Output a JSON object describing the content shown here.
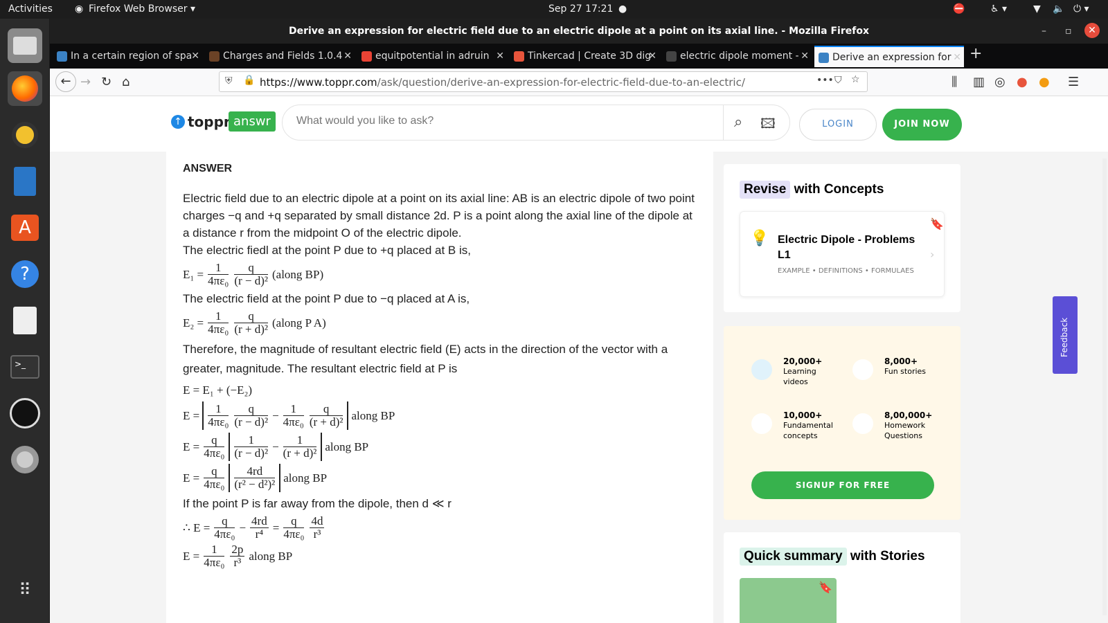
{
  "system": {
    "activities": "Activities",
    "app_menu": "Firefox Web Browser ▾",
    "clock": "Sep 27  17:21"
  },
  "window": {
    "title": "Derive an expression for electric field due to an electric dipole at a point on its axial line. - Mozilla Firefox"
  },
  "tabs": [
    {
      "label": "In a certain region of spa",
      "color": "#3b82c4"
    },
    {
      "label": "Charges and Fields 1.0.4",
      "color": "#6b4226"
    },
    {
      "label": "equitpotential in adruin",
      "color": "#ea4335"
    },
    {
      "label": "Tinkercad | Create 3D dig",
      "color": "#e8553c"
    },
    {
      "label": "electric dipole moment -",
      "color": "#444444"
    },
    {
      "label": "Derive an expression for",
      "color": "#3b82c4"
    }
  ],
  "url": {
    "host": "https://www.toppr.com",
    "path": "/ask/question/derive-an-expression-for-electric-field-due-to-an-electric/"
  },
  "header": {
    "logo": "toppr",
    "answr": "answr",
    "search_placeholder": "What would you like to ask?",
    "login": "LOGIN",
    "join": "JOIN NOW"
  },
  "answer": {
    "heading": "ANSWER",
    "p1": "Electric field due to an electric dipole at a point on its axial line: AB is an electric dipole of two point charges −q and +q separated by small distance 2d. P  is a point along the axial line of the dipole at a distance r from the midpoint O of the electric dipole.",
    "p2": "The electric fiedl at the point P  due to +q placed at B is,",
    "e1_label": "E₁ =",
    "e1_suffix": "(along BP)",
    "p3": "The electric field at the point P  due to −q placed at A is,",
    "e2_label": "E₂ =",
    "e2_suffix": "(along P A)",
    "p4": "Therefore, the magnitude of resultant electric field (E) acts in the direction of the vector with a greater, magnitude. The resultant electric field at P  is",
    "e3": "E = E₁ + (−E₂)",
    "along": "along BP",
    "p5": "If the point P  is far away from the dipole, then d ≪ r",
    "therefore": "∴ E ="
  },
  "sidebar": {
    "revise_pill": "Revise",
    "revise_rest": "with Concepts",
    "card_title": "Electric Dipole - Problems L1",
    "card_tags": "EXAMPLE • DEFINITIONS • FORMULAES",
    "stats": [
      {
        "num": "20,000+",
        "label": "Learning videos"
      },
      {
        "num": "8,000+",
        "label": "Fun stories"
      },
      {
        "num": "10,000+",
        "label": "Fundamental concepts"
      },
      {
        "num": "8,00,000+",
        "label": "Homework Questions"
      }
    ],
    "signup": "SIGNUP FOR FREE",
    "summary_pill": "Quick summary",
    "summary_rest": "with Stories",
    "feedback": "Feedback"
  }
}
